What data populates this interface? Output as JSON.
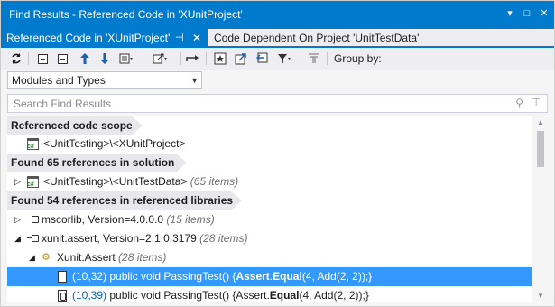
{
  "window": {
    "title": "Find Results - Referenced Code in 'XUnitProject'",
    "controls": [
      "▾",
      "□",
      "✕"
    ]
  },
  "tabs": [
    {
      "label": "Referenced Code in 'XUnitProject'",
      "pin": "⊣",
      "close": "✕"
    },
    {
      "label": "Code Dependent On Project 'UnitTestData'"
    }
  ],
  "toolbar": {
    "group_by_label": "Group by:",
    "icons": [
      "refresh-icon",
      "expand-all-icon",
      "collapse-all-icon",
      "previous-icon",
      "next-icon",
      "export-icon",
      "open-icon",
      "goto-icon",
      "bookmark-icon",
      "export-results-icon",
      "import-icon",
      "filter-icon",
      "filter-clear-icon"
    ]
  },
  "scope_select": {
    "value": "Modules and Types"
  },
  "search": {
    "placeholder": "Search Find Results"
  },
  "results": {
    "header1": "Referenced code scope",
    "scope_item": "<UnitTesting>\\<XUnitProject>",
    "header2": "Found 65 references in solution",
    "solution_item": {
      "name": "<UnitTesting>\\<UnitTestData>",
      "count": "(65 items)"
    },
    "header3": "Found 54 references in referenced libraries",
    "lib1": {
      "name": "mscorlib, Version=4.0.0.0",
      "count": "(15 items)"
    },
    "lib2": {
      "name": "xunit.assert, Version=2.1.0.3179",
      "count": "(28 items)"
    },
    "class1": {
      "name": "Xunit.Assert",
      "count": "(28 items)"
    },
    "occ1": {
      "loc": "(10,32)",
      "pre": " public void PassingTest() {",
      "bold1": "Assert",
      "mid": ".",
      "bold2": "Equal",
      "post": "(4, Add(2, 2));}"
    },
    "occ2": {
      "loc": "(10,39)",
      "pre": " public void PassingTest() {Assert.",
      "bold1": "Equal",
      "post": "(4, Add(2, 2));}"
    }
  },
  "colors": {
    "accent": "#007acc",
    "selection": "#3399ff",
    "header_bg": "#e8e8ec"
  }
}
